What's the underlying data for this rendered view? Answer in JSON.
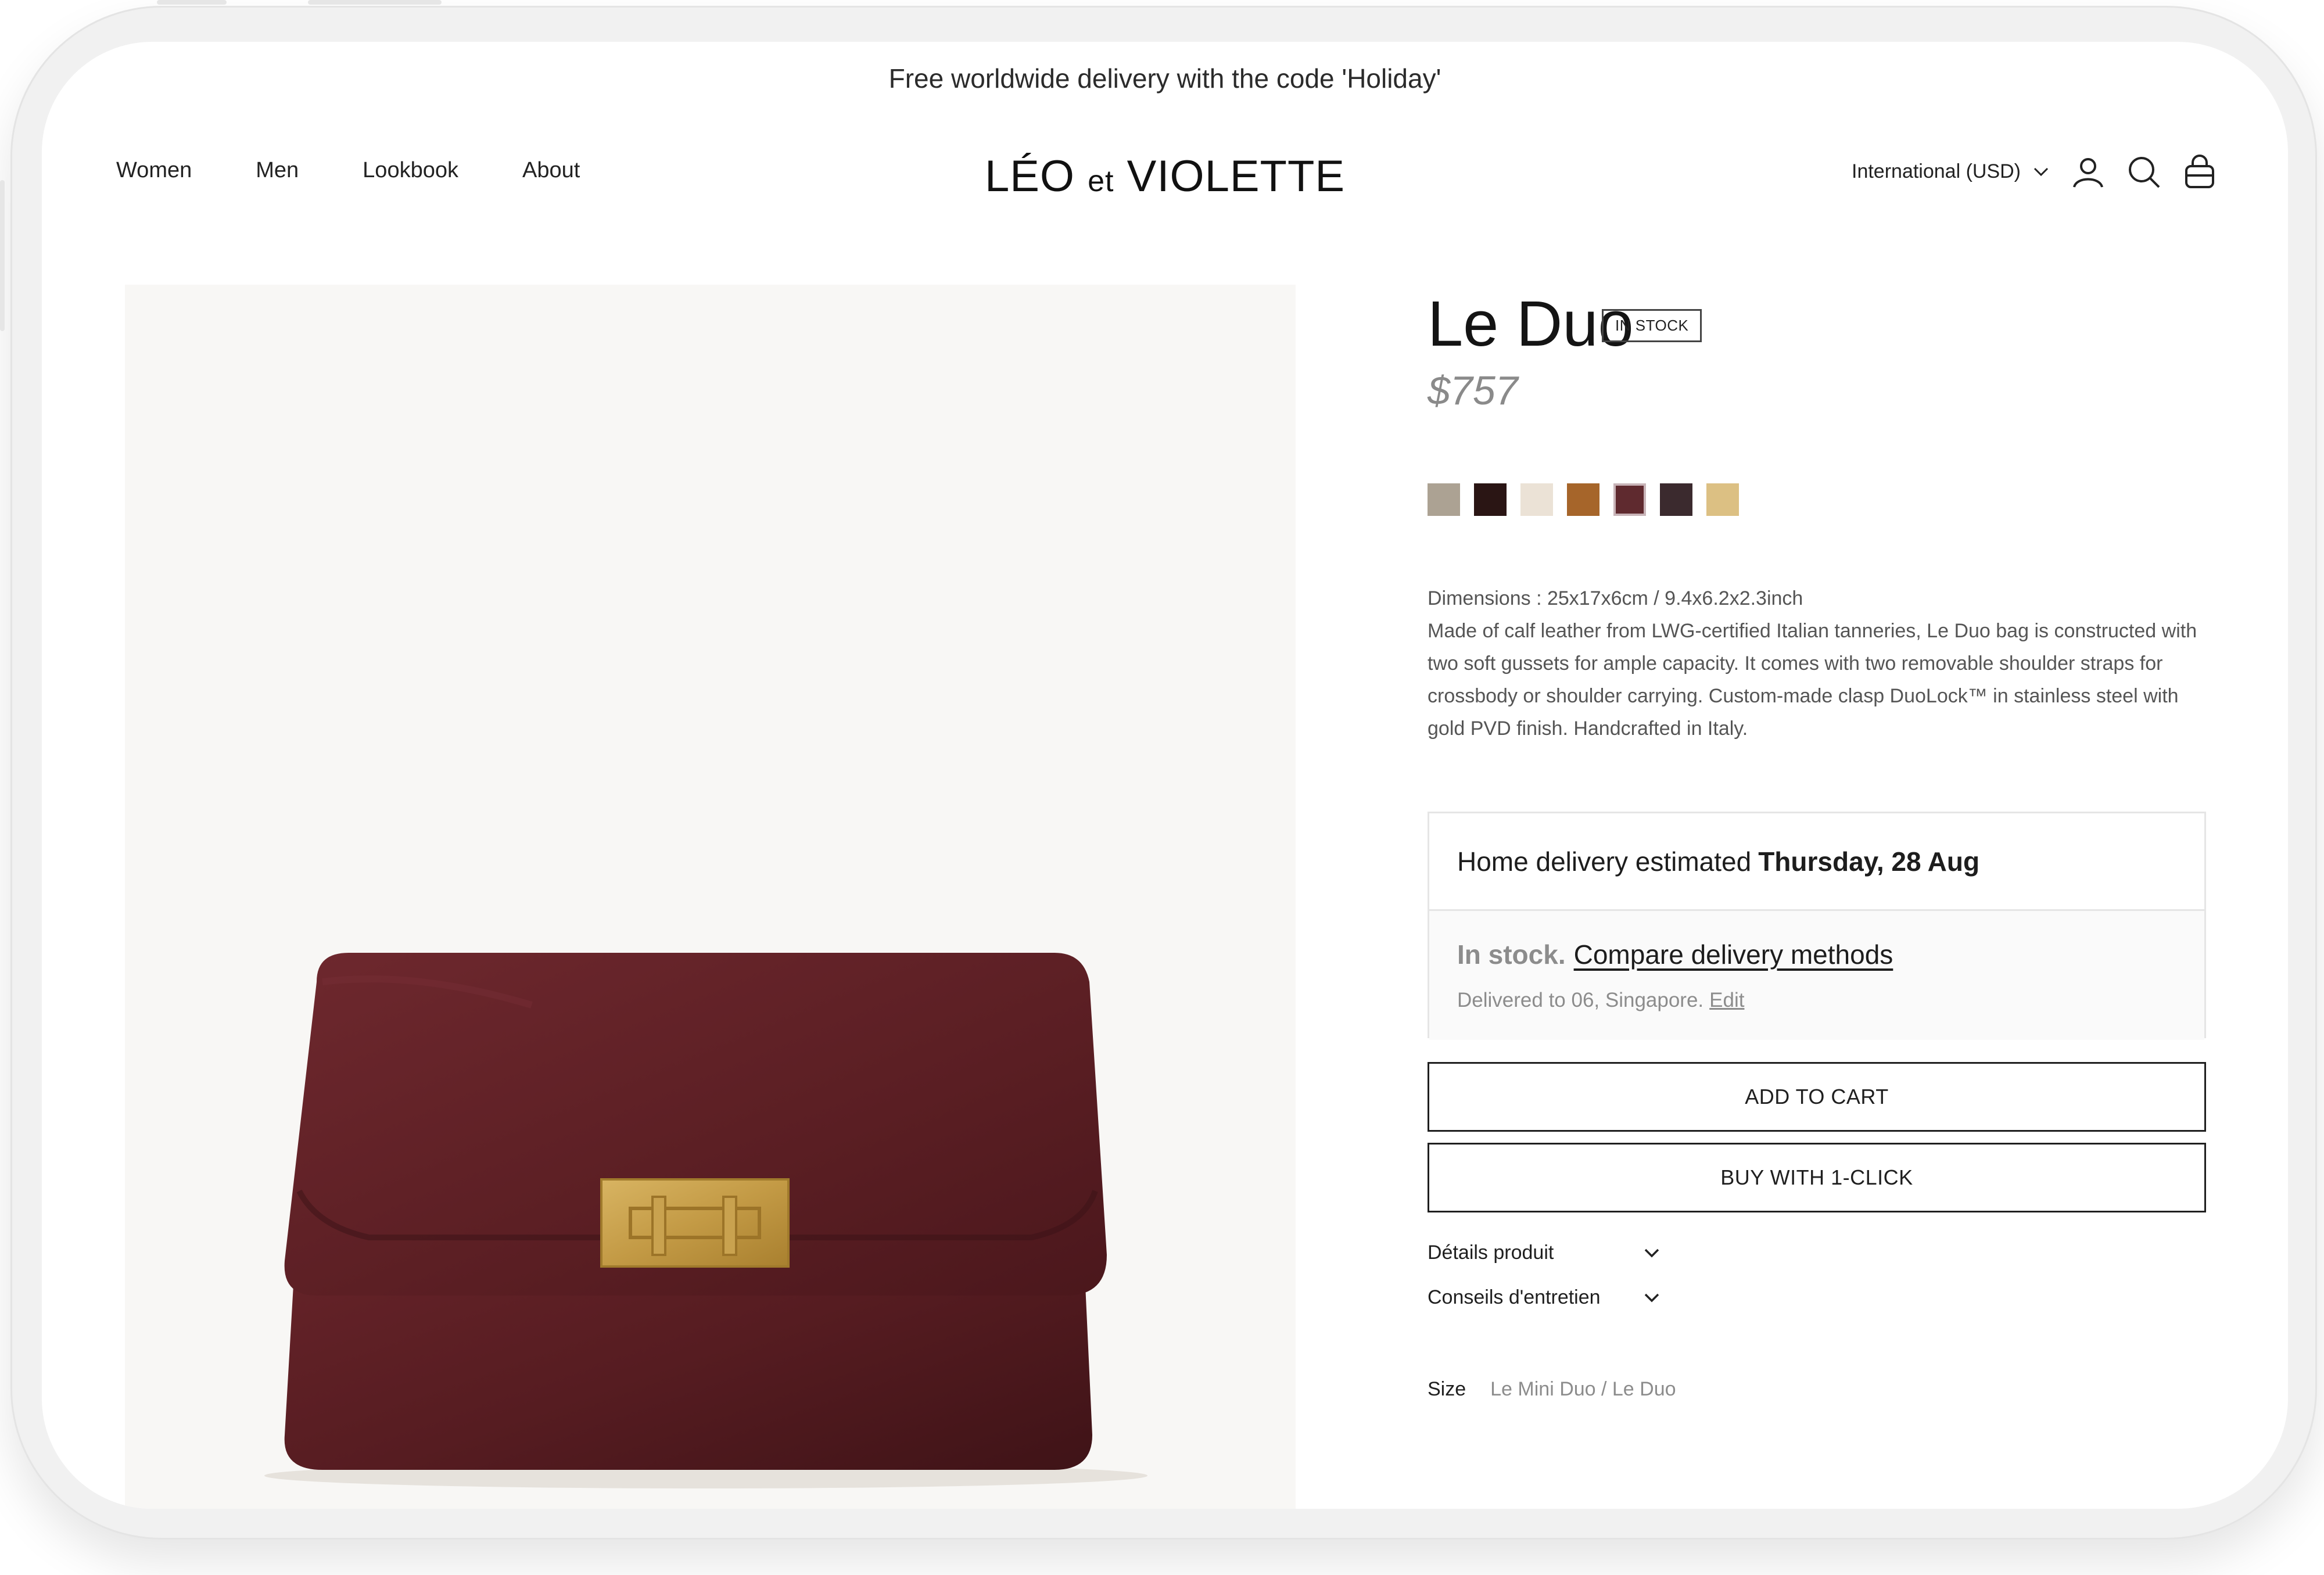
{
  "announcement": "Free worldwide delivery with the code 'Holiday'",
  "nav": {
    "items": [
      {
        "label": "Women"
      },
      {
        "label": "Men"
      },
      {
        "label": "Lookbook"
      },
      {
        "label": "About"
      }
    ]
  },
  "logo": {
    "part1": "LÉO",
    "part2": "et",
    "part3": "VIOLETTE"
  },
  "header": {
    "region_label": "International (USD)",
    "icons": [
      "account-icon",
      "search-icon",
      "cart-icon"
    ]
  },
  "product": {
    "title": "Le Duo",
    "badge": "IN STOCK",
    "price": "$757",
    "swatches": [
      {
        "color": "#aca293",
        "selected": false
      },
      {
        "color": "#2a1514",
        "selected": false
      },
      {
        "color": "#ebe2d6",
        "selected": false
      },
      {
        "color": "#a6652a",
        "selected": false
      },
      {
        "color": "#5f2a2f",
        "selected": true
      },
      {
        "color": "#3b2a2e",
        "selected": false
      },
      {
        "color": "#dcc083",
        "selected": false
      }
    ],
    "dimensions": "Dimensions : 25x17x6cm / 9.4x6.2x2.3inch",
    "description": "Made of calf leather from LWG-certified Italian tanneries, Le Duo bag is constructed with two soft gussets for ample capacity. It comes with two removable shoulder straps for crossbody or shoulder carrying. Custom-made clasp DuoLock™ in stainless steel with gold PVD finish. Handcrafted in Italy."
  },
  "delivery": {
    "estimate_prefix": "Home delivery estimated",
    "estimate_date": "Thursday, 28 Aug",
    "stock_label": "In stock.",
    "compare_link": "Compare delivery methods",
    "delivered_to": "Delivered to 06, Singapore.",
    "edit_link": "Edit"
  },
  "buttons": {
    "add_to_cart": "ADD TO CART",
    "buy_1click": "BUY WITH 1-CLICK"
  },
  "accordions": [
    {
      "label": "Détails produit"
    },
    {
      "label": "Conseils d'entretien"
    }
  ],
  "size": {
    "label": "Size",
    "options": "Le Mini Duo / Le Duo"
  },
  "colors": {
    "bag": "#5a1d22",
    "clasp": "#c9a24f",
    "image_bg": "#f8f7f5"
  }
}
